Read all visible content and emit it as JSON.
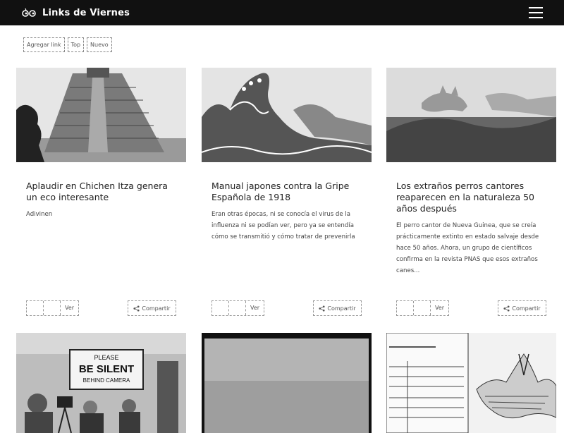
{
  "app": {
    "title": "Links de Viernes"
  },
  "filters": [
    {
      "label": "Agregar link"
    },
    {
      "label": "Top"
    },
    {
      "label": "Nuevo"
    }
  ],
  "actions": {
    "view_label": "Ver",
    "share_label": "Compartir"
  },
  "cards": [
    {
      "title": "Aplaudir en Chichen Itza genera un eco interesante",
      "description": "Adivinen"
    },
    {
      "title": "Manual japones contra la Gripe Española de 1918",
      "description": "Eran otras épocas, ni se conocía el virus de la influenza ni se podían ver, pero ya se entendía cómo se transmitió y cómo tratar de prevenirla"
    },
    {
      "title": "Los extraños perros cantores reaparecen en la naturaleza 50 años después",
      "description": "El perro cantor de Nueva Guinea, que se creía prácticamente extinto en estado salvaje desde hace 50 años. Ahora, un grupo de científicos confirma en la revista PNAS que esos extraños canes..."
    },
    {
      "sign_line1": "PLEASE",
      "sign_line2": "BE SILENT",
      "sign_line3": "BEHIND CAMERA"
    },
    {},
    {}
  ]
}
